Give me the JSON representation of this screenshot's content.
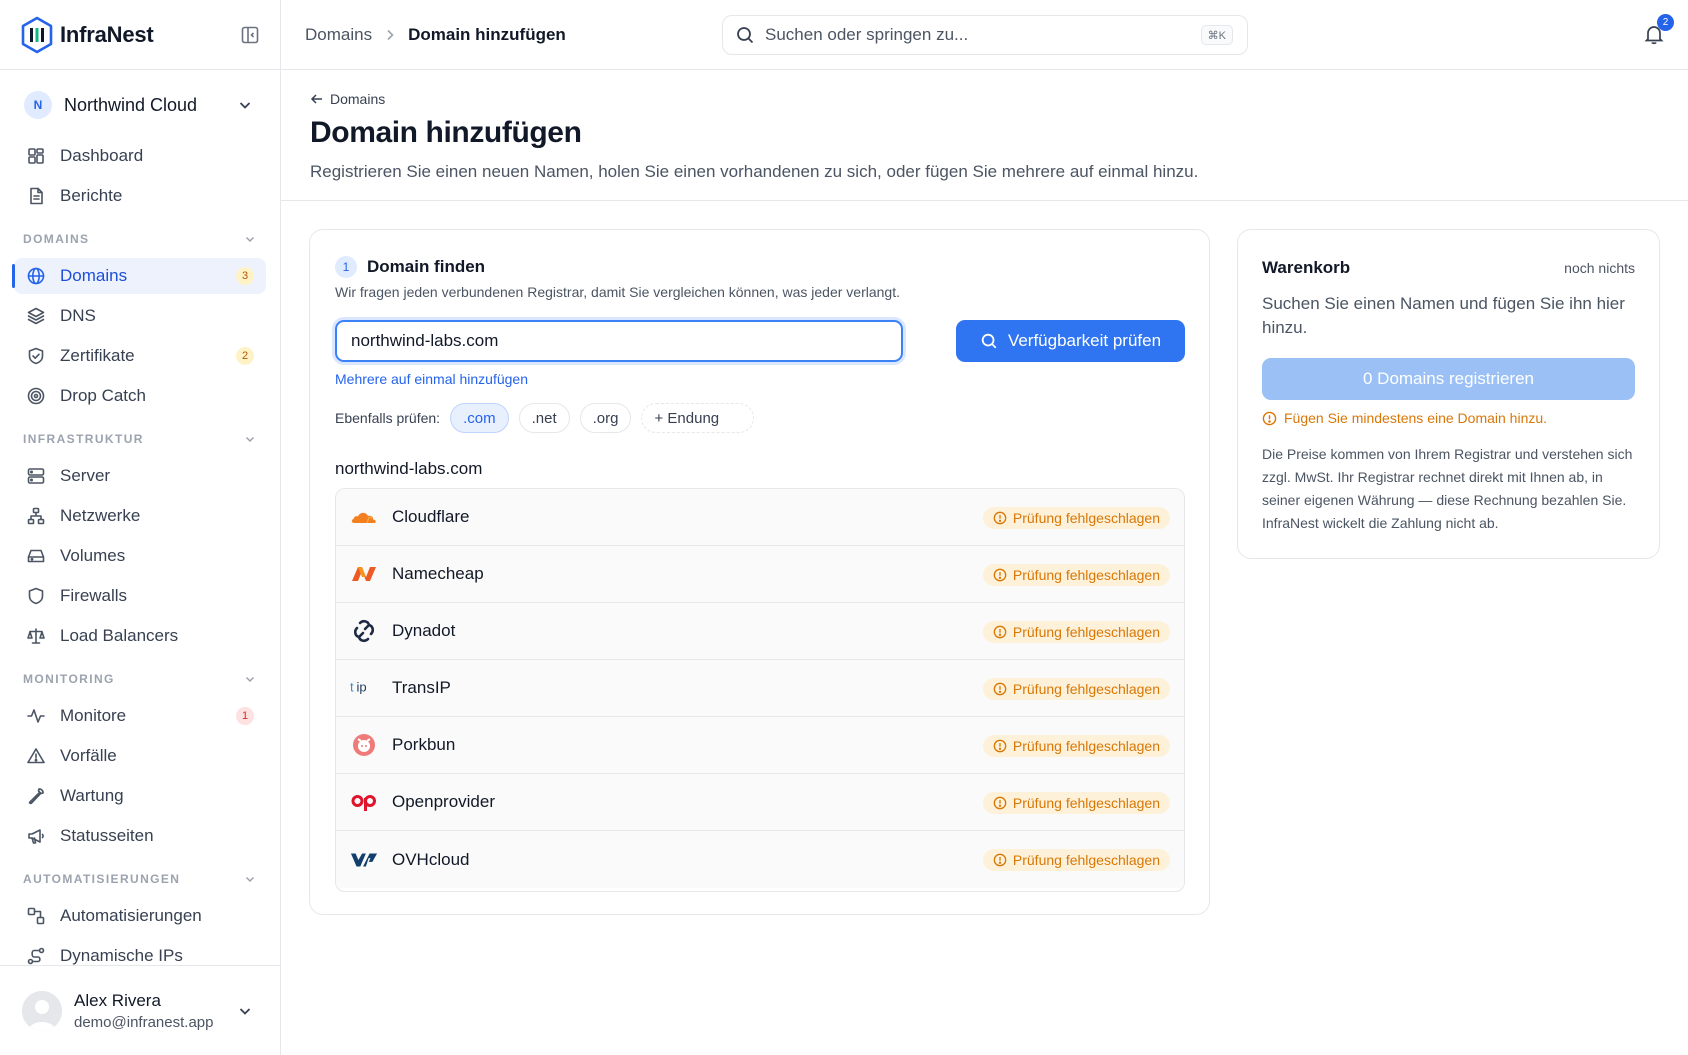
{
  "app": {
    "name": "InfraNest"
  },
  "org": {
    "initial": "N",
    "name": "Northwind Cloud"
  },
  "nav": {
    "top": [
      {
        "label": "Dashboard",
        "icon": "dashboard-icon"
      },
      {
        "label": "Berichte",
        "icon": "report-icon"
      }
    ],
    "sections": [
      {
        "title": "DOMAINS",
        "items": [
          {
            "label": "Domains",
            "icon": "globe-icon",
            "badge": "3",
            "active": true
          },
          {
            "label": "DNS",
            "icon": "layers-icon"
          },
          {
            "label": "Zertifikate",
            "icon": "shield-check-icon",
            "badge": "2"
          },
          {
            "label": "Drop Catch",
            "icon": "target-icon"
          }
        ]
      },
      {
        "title": "INFRASTRUKTUR",
        "items": [
          {
            "label": "Server",
            "icon": "server-icon"
          },
          {
            "label": "Netzwerke",
            "icon": "network-icon"
          },
          {
            "label": "Volumes",
            "icon": "hard-drive-icon"
          },
          {
            "label": "Firewalls",
            "icon": "shield-icon"
          },
          {
            "label": "Load Balancers",
            "icon": "scale-icon"
          }
        ]
      },
      {
        "title": "MONITORING",
        "items": [
          {
            "label": "Monitore",
            "icon": "activity-icon",
            "badge": "1"
          },
          {
            "label": "Vorfälle",
            "icon": "alert-triangle-icon"
          },
          {
            "label": "Wartung",
            "icon": "wrench-icon"
          },
          {
            "label": "Statusseiten",
            "icon": "megaphone-icon"
          }
        ]
      },
      {
        "title": "AUTOMATISIERUNGEN",
        "items": [
          {
            "label": "Automatisierungen",
            "icon": "workflow-icon"
          },
          {
            "label": "Dynamische IPs",
            "icon": "route-icon"
          }
        ]
      }
    ]
  },
  "user": {
    "name": "Alex Rivera",
    "email": "demo@infranest.app"
  },
  "topbar": {
    "breadcrumb": [
      "Domains",
      "Domain hinzufügen"
    ],
    "search_placeholder": "Suchen oder springen zu...",
    "search_shortcut": "⌘K",
    "notification_count": "2"
  },
  "page": {
    "back_label": "Domains",
    "title": "Domain hinzufügen",
    "subtitle": "Registrieren Sie einen neuen Namen, holen Sie einen vorhandenen zu sich, oder fügen Sie mehrere auf einmal hinzu."
  },
  "find": {
    "step_number": "1",
    "title": "Domain finden",
    "description": "Wir fragen jeden verbundenen Registrar, damit Sie vergleichen können, was jeder verlangt.",
    "input_value": "northwind-labs.com",
    "check_button": "Verfügbarkeit prüfen",
    "multi_link": "Mehrere auf einmal hinzufügen",
    "also_label": "Ebenfalls prüfen:",
    "tlds": [
      ".com",
      ".net",
      ".org"
    ],
    "add_tld": "+ Endung",
    "result_domain": "northwind-labs.com",
    "registrars": [
      {
        "name": "Cloudflare",
        "status": "Prüfung fehlgeschlagen",
        "logo": "cloudflare-logo"
      },
      {
        "name": "Namecheap",
        "status": "Prüfung fehlgeschlagen",
        "logo": "namecheap-logo"
      },
      {
        "name": "Dynadot",
        "status": "Prüfung fehlgeschlagen",
        "logo": "dynadot-logo"
      },
      {
        "name": "TransIP",
        "status": "Prüfung fehlgeschlagen",
        "logo": "transip-logo"
      },
      {
        "name": "Porkbun",
        "status": "Prüfung fehlgeschlagen",
        "logo": "porkbun-logo"
      },
      {
        "name": "Openprovider",
        "status": "Prüfung fehlgeschlagen",
        "logo": "openprovider-logo"
      },
      {
        "name": "OVHcloud",
        "status": "Prüfung fehlgeschlagen",
        "logo": "ovhcloud-logo"
      }
    ]
  },
  "cart": {
    "title": "Warenkorb",
    "state": "noch nichts",
    "description": "Suchen Sie einen Namen und fügen Sie ihn hier hinzu.",
    "register_button": "0 Domains registrieren",
    "warning": "Fügen Sie mindestens eine Domain hinzu.",
    "note": "Die Preise kommen von Ihrem Registrar und verstehen sich zzgl. MwSt. Ihr Registrar rechnet direkt mit Ihnen ab, in seiner eigenen Währung — diese Rechnung bezahlen Sie. InfraNest wickelt die Zahlung nicht ab."
  },
  "colors": {
    "accent": "#2f74f0",
    "warning": "#d97706",
    "warning_bg": "#fdf2d9",
    "muted_button": "#9ac0f6"
  }
}
